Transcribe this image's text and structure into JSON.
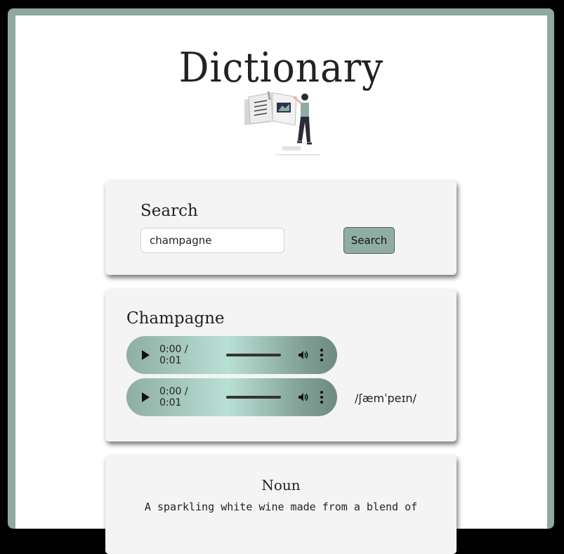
{
  "app": {
    "title": "Dictionary"
  },
  "search": {
    "label": "Search",
    "input_value": "champagne",
    "button_label": "Search"
  },
  "result": {
    "word": "Champagne",
    "audio_players": [
      {
        "time": "0:00 / 0:01"
      },
      {
        "time": "0:00 / 0:01"
      }
    ],
    "phonetic": "/ʃæmˈpeɪn/"
  },
  "meaning": {
    "part_of_speech": "Noun",
    "definition": "A sparkling white wine made from a blend of"
  },
  "colors": {
    "accent": "#8fada3",
    "frame": "#8fa8a0",
    "card_bg": "#f3f4f3"
  },
  "icons": {
    "illustration": "person-reading-book-illustration",
    "play": "play-icon",
    "volume": "volume-icon",
    "more": "more-options-icon"
  }
}
